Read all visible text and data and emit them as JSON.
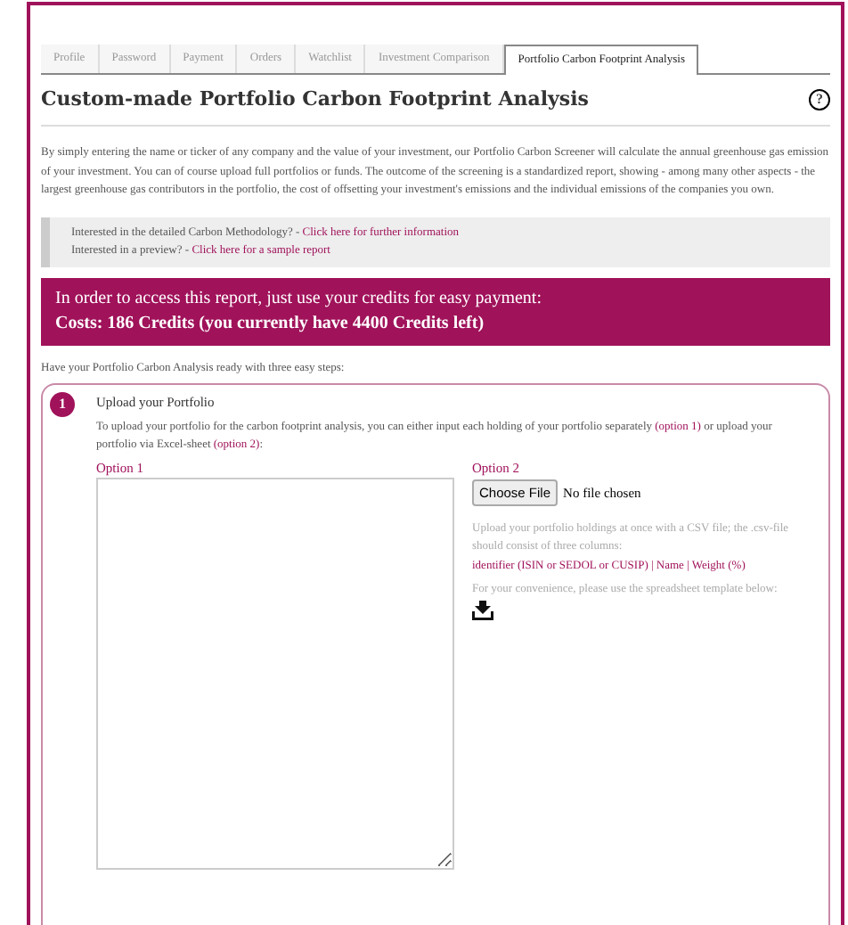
{
  "tabs": [
    {
      "label": "Profile",
      "selected": false
    },
    {
      "label": "Password",
      "selected": false
    },
    {
      "label": "Payment",
      "selected": false
    },
    {
      "label": "Orders",
      "selected": false
    },
    {
      "label": "Watchlist",
      "selected": false
    },
    {
      "label": "Investment Comparison",
      "selected": false
    },
    {
      "label": "Portfolio Carbon Footprint Analysis",
      "selected": true
    }
  ],
  "title": "Custom-made Portfolio Carbon Footprint Analysis",
  "help_icon": "?",
  "intro": "By simply entering the name or ticker of any company and the value of your investment, our Portfolio Carbon Screener will calculate the annual greenhouse gas emission of your investment. You can of course upload full portfolios or funds. The outcome of the screening is a standardized report, showing - among many other aspects - the largest greenhouse gas contributors in the portfolio, the cost of offsetting your investment's emissions and the individual emissions of the companies you own.",
  "info_lines": [
    {
      "text": "Interested in the detailed Carbon Methodology? - ",
      "link": "Click here for further information"
    },
    {
      "text": "Interested in a preview? - ",
      "link": "Click here for a sample report"
    }
  ],
  "banner": {
    "line": "In order to access this report, just use your credits for easy payment:",
    "costs": "Costs: 186 Credits (you currently have 4400 Credits left)"
  },
  "steps_intro": "Have your Portfolio Carbon Analysis ready with three easy steps:",
  "step": {
    "number": "1",
    "title": "Upload your Portfolio",
    "text_before": "To upload your portfolio for the carbon footprint analysis, you can either input each holding of your portfolio separately ",
    "link1": "(option 1)",
    "text_middle": " or upload your portfolio via Excel-sheet ",
    "link2": "(option 2)",
    "text_after": ":",
    "option1_label": "Option 1",
    "option2_label": "Option 2",
    "file_button": "Choose File",
    "file_status": "No file chosen",
    "csv_help": "Upload your portfolio holdings at once with a CSV file; the .csv-file should consist of three columns:",
    "columns": "identifier (ISIN or SEDOL or CUSIP) | Name | Weight (%)",
    "template_help": "For your convenience, please use the spreadsheet template below:"
  }
}
